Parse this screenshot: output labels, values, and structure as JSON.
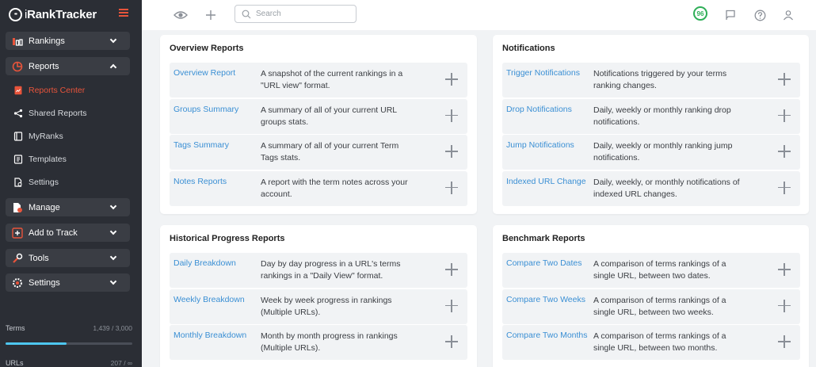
{
  "brand": {
    "logo_mark": "••",
    "name_light": "i",
    "name_bold": "RankTracker"
  },
  "sidebar": {
    "rankings": "Rankings",
    "reports": "Reports",
    "reports_center": "Reports Center",
    "shared_reports": "Shared Reports",
    "myranks": "MyRanks",
    "templates": "Templates",
    "settings_sub": "Settings",
    "manage": "Manage",
    "add_to_track": "Add to Track",
    "tools": "Tools",
    "settings": "Settings",
    "terms_label": "Terms",
    "terms_value": "1,439 / 3,000",
    "terms_fraction": 0.48,
    "urls_label": "URLs",
    "urls_value": "207 / ∞"
  },
  "topbar": {
    "search_placeholder": "Search",
    "score": "96",
    "icons": [
      "eye-icon",
      "plus-icon",
      "search-icon",
      "flag-icon",
      "help-icon",
      "user-icon"
    ]
  },
  "colors": {
    "accent": "#e8543b",
    "link": "#3a8fd4",
    "score": "#2eae57",
    "progress": "#4dc6ef"
  },
  "cards": [
    {
      "title": "Overview Reports",
      "rows": [
        {
          "name": "Overview Report",
          "desc": "A snapshot of the current rankings in a \"URL view\" format."
        },
        {
          "name": "Groups Summary",
          "desc": "A summary of all of your current URL groups stats."
        },
        {
          "name": "Tags Summary",
          "desc": "A summary of all of your current Term Tags stats."
        },
        {
          "name": "Notes Reports",
          "desc": "A report with the term notes across your account."
        }
      ]
    },
    {
      "title": "Notifications",
      "rows": [
        {
          "name": "Trigger Notifications",
          "desc": "Notifications triggered by your terms ranking changes."
        },
        {
          "name": "Drop Notifications",
          "desc": "Daily, weekly or monthly ranking drop notifications."
        },
        {
          "name": "Jump Notifications",
          "desc": "Daily, weekly or monthly ranking jump notifications."
        },
        {
          "name": "Indexed URL Change",
          "desc": "Daily, weekly, or monthly notifications of indexed URL changes."
        }
      ]
    },
    {
      "title": "Historical Progress Reports",
      "rows": [
        {
          "name": "Daily Breakdown",
          "desc": "Day by day progress in a URL's terms rankings in a \"Daily View\" format."
        },
        {
          "name": "Weekly Breakdown",
          "desc": "Week by week progress in rankings (Multiple URLs)."
        },
        {
          "name": "Monthly Breakdown",
          "desc": "Month by month progress in rankings (Multiple URLs)."
        }
      ]
    },
    {
      "title": "Benchmark Reports",
      "rows": [
        {
          "name": "Compare Two Dates",
          "desc": "A comparison of terms rankings of a single URL, between two dates."
        },
        {
          "name": "Compare Two Weeks",
          "desc": "A comparison of terms rankings of a single URL, between two weeks."
        },
        {
          "name": "Compare Two Months",
          "desc": "A comparison of terms rankings of a single URL, between two months."
        }
      ]
    }
  ]
}
